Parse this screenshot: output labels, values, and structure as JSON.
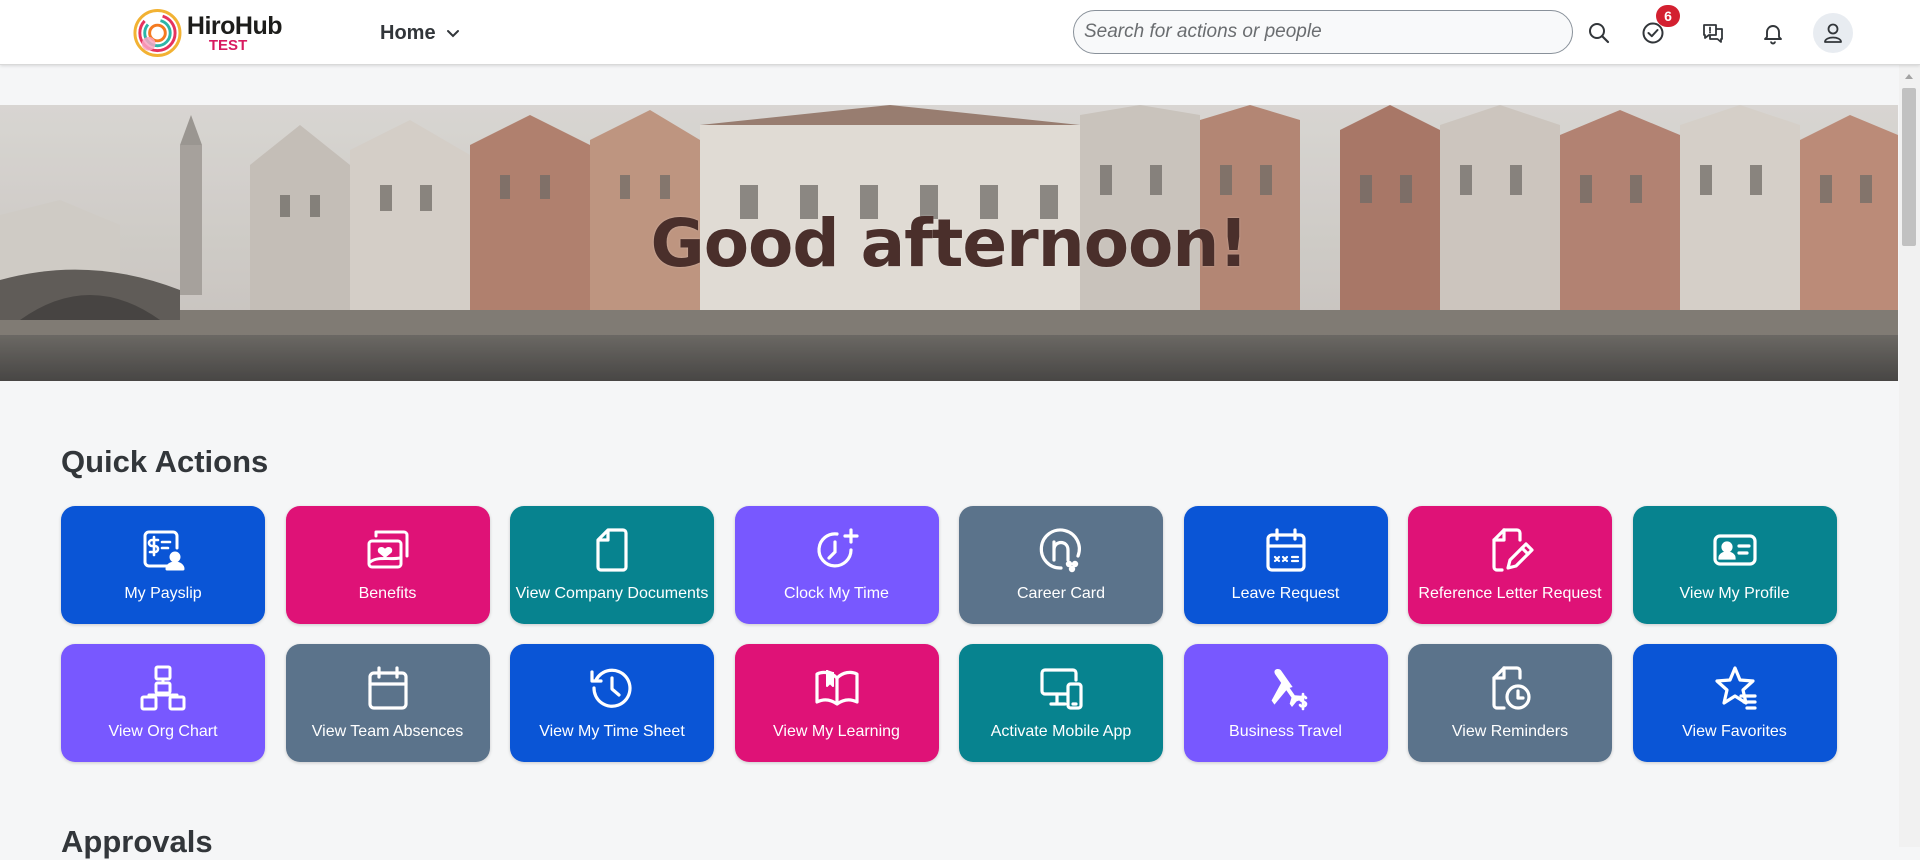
{
  "header": {
    "logo_name": "HiroHub",
    "logo_env": "TEST",
    "nav_label": "Home",
    "search_placeholder": "Search for actions or people",
    "tasks_badge": "6"
  },
  "hero": {
    "greeting": "Good afternoon!"
  },
  "quick_actions": {
    "title": "Quick Actions",
    "tiles": [
      {
        "label": "My Payslip",
        "color": "#0a55d6",
        "icon": "payslip-icon"
      },
      {
        "label": "Benefits",
        "color": "#df1277",
        "icon": "benefits-icon"
      },
      {
        "label": "View Company Documents",
        "color": "#07838f",
        "icon": "document-icon"
      },
      {
        "label": "Clock My Time",
        "color": "#7858ff",
        "icon": "clock-add-icon"
      },
      {
        "label": "Career Card",
        "color": "#5b738b",
        "icon": "career-card-icon"
      },
      {
        "label": "Leave Request",
        "color": "#0a55d6",
        "icon": "calendar-icon"
      },
      {
        "label": "Reference Letter Request",
        "color": "#df1277",
        "icon": "document-edit-icon"
      },
      {
        "label": "View My Profile",
        "color": "#07838f",
        "icon": "id-card-icon"
      },
      {
        "label": "View Org Chart",
        "color": "#7858ff",
        "icon": "org-chart-icon"
      },
      {
        "label": "View Team Absences",
        "color": "#5b738b",
        "icon": "calendar-empty-icon"
      },
      {
        "label": "View My Time Sheet",
        "color": "#0a55d6",
        "icon": "history-icon"
      },
      {
        "label": "View My Learning",
        "color": "#df1277",
        "icon": "book-icon"
      },
      {
        "label": "Activate Mobile App",
        "color": "#07838f",
        "icon": "devices-icon"
      },
      {
        "label": "Business Travel",
        "color": "#7858ff",
        "icon": "travel-icon"
      },
      {
        "label": "View Reminders",
        "color": "#5b738b",
        "icon": "reminder-icon"
      },
      {
        "label": "View Favorites",
        "color": "#0a55d6",
        "icon": "favorites-icon"
      }
    ]
  },
  "approvals": {
    "title": "Approvals"
  }
}
